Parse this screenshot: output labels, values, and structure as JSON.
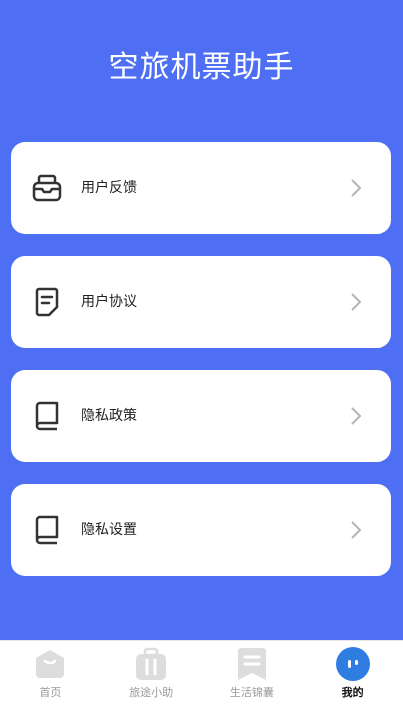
{
  "app": {
    "title": "空旅机票助手"
  },
  "menu": {
    "items": [
      {
        "label": "用户反馈",
        "icon": "inbox-icon"
      },
      {
        "label": "用户协议",
        "icon": "document-icon"
      },
      {
        "label": "隐私政策",
        "icon": "book-icon"
      },
      {
        "label": "隐私设置",
        "icon": "book-icon"
      }
    ]
  },
  "tabbar": {
    "tabs": [
      {
        "label": "首页",
        "icon": "home-icon",
        "active": false
      },
      {
        "label": "旅途小助",
        "icon": "luggage-icon",
        "active": false
      },
      {
        "label": "生活锦囊",
        "icon": "bookmark-icon",
        "active": false
      },
      {
        "label": "我的",
        "icon": "profile-icon",
        "active": true
      }
    ]
  },
  "colors": {
    "hero_background": "#4e6ff3",
    "active_tab_icon": "#2f7de1",
    "inactive_tab_icon": "#dddddd"
  }
}
